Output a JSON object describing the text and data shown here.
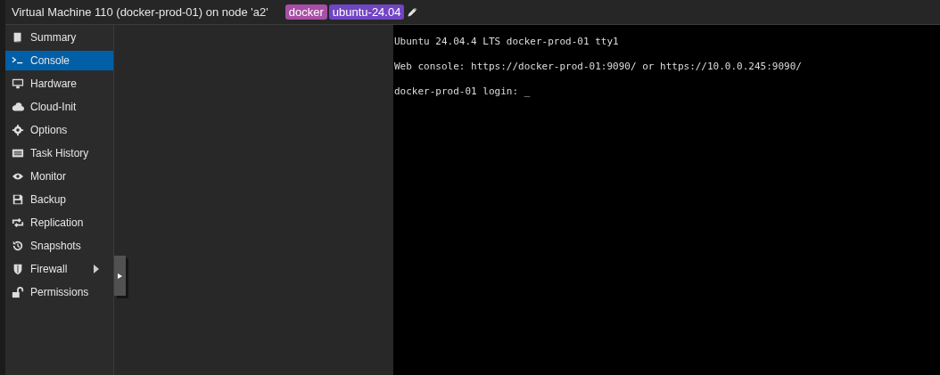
{
  "header": {
    "title": "Virtual Machine 110 (docker-prod-01) on node 'a2'",
    "tags": [
      {
        "label": "docker",
        "color": "#a84ea6"
      },
      {
        "label": "ubuntu-24.04",
        "color": "#7145c4"
      }
    ]
  },
  "sidebar": {
    "items": [
      {
        "label": "Summary",
        "selected": false,
        "expandable": false
      },
      {
        "label": "Console",
        "selected": true,
        "expandable": false
      },
      {
        "label": "Hardware",
        "selected": false,
        "expandable": false
      },
      {
        "label": "Cloud-Init",
        "selected": false,
        "expandable": false
      },
      {
        "label": "Options",
        "selected": false,
        "expandable": false
      },
      {
        "label": "Task History",
        "selected": false,
        "expandable": false
      },
      {
        "label": "Monitor",
        "selected": false,
        "expandable": false
      },
      {
        "label": "Backup",
        "selected": false,
        "expandable": false
      },
      {
        "label": "Replication",
        "selected": false,
        "expandable": false
      },
      {
        "label": "Snapshots",
        "selected": false,
        "expandable": false
      },
      {
        "label": "Firewall",
        "selected": false,
        "expandable": true
      },
      {
        "label": "Permissions",
        "selected": false,
        "expandable": false
      }
    ]
  },
  "console": {
    "lines": [
      "Ubuntu 24.04.4 LTS docker-prod-01 tty1",
      "Web console: https://docker-prod-01:9090/ or https://10.0.0.245:9090/",
      "docker-prod-01 login: _"
    ]
  }
}
